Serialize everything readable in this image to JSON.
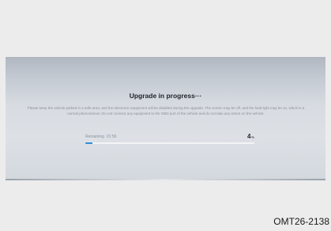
{
  "upgrade": {
    "title": "Upgrade in progress···",
    "message": "Please keep the vehicle parked in a safe area, and the electronic equipment will be disabled during the upgrade. The screen may be off, and the fault light may be on, which is a normal phenomenon; Do not connect any equipment to the OBD port of the vehicle and do not take any action on the vehicle.",
    "remaining_label": "Remaining",
    "remaining_time": "01:56",
    "percent": "4",
    "percent_unit": "%",
    "progress": 0.04,
    "accent_color": "#2f8fd8"
  },
  "figure_code": "OMT26-2138"
}
